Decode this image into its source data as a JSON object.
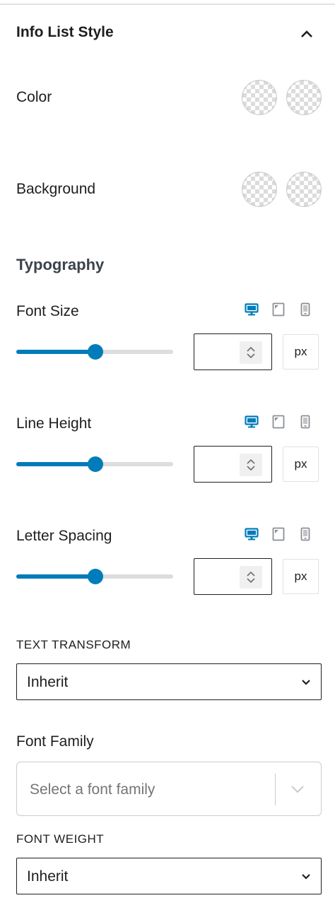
{
  "panel": {
    "title": "Info List Style"
  },
  "color": {
    "label": "Color"
  },
  "background": {
    "label": "Background"
  },
  "typography": {
    "heading": "Typography",
    "font_size": {
      "label": "Font Size",
      "value": "",
      "unit": "px",
      "slider_fraction": 0.5
    },
    "line_height": {
      "label": "Line Height",
      "value": "",
      "unit": "px",
      "slider_fraction": 0.5
    },
    "letter_spacing": {
      "label": "Letter Spacing",
      "value": "",
      "unit": "px",
      "slider_fraction": 0.5
    },
    "text_transform": {
      "label": "TEXT TRANSFORM",
      "value": "Inherit"
    },
    "font_family": {
      "label": "Font Family",
      "placeholder": "Select a font family"
    },
    "font_weight": {
      "label": "FONT WEIGHT",
      "value": "Inherit"
    }
  },
  "devices": [
    "desktop-icon",
    "tablet-icon",
    "mobile-icon"
  ],
  "colors": {
    "accent": "#007cba",
    "inactive_icon": "#8c8f94",
    "track": "#dddddd"
  }
}
